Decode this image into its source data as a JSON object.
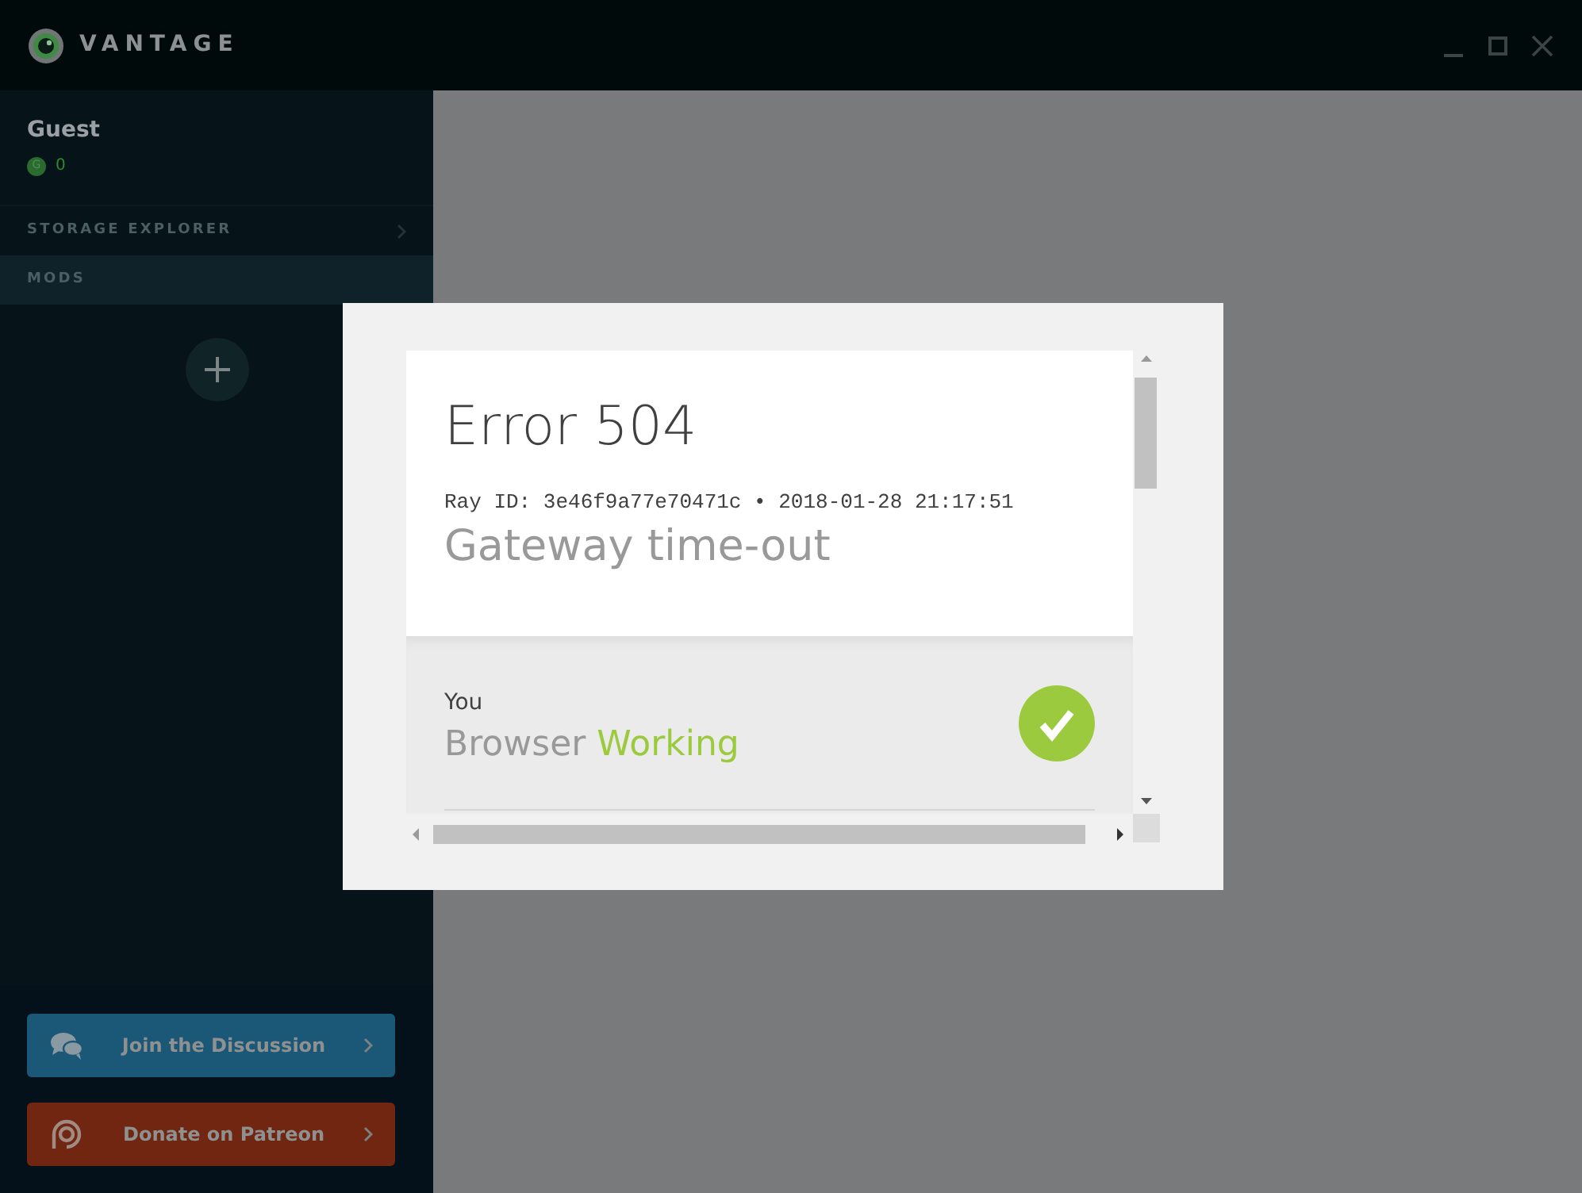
{
  "window": {
    "title": "VANTAGE"
  },
  "user": {
    "name": "Guest",
    "credit_badge": "G",
    "credits": "0"
  },
  "sidebar": {
    "items": [
      {
        "label": "STORAGE EXPLORER",
        "selected": false,
        "chevron": true
      },
      {
        "label": "MODS",
        "selected": true,
        "chevron": false
      }
    ]
  },
  "links": [
    {
      "label": "Join the Discussion",
      "kind": "discussion"
    },
    {
      "label": "Donate on Patreon",
      "kind": "patreon"
    }
  ],
  "dialog": {
    "title": "Error 504",
    "ray_id": "Ray ID: 3e46f9a77e70471c • 2018-01-28 21:17:51",
    "subtitle": "Gateway time-out",
    "status": {
      "label": "You",
      "name": "Browser",
      "state": "Working",
      "ok": true
    }
  }
}
